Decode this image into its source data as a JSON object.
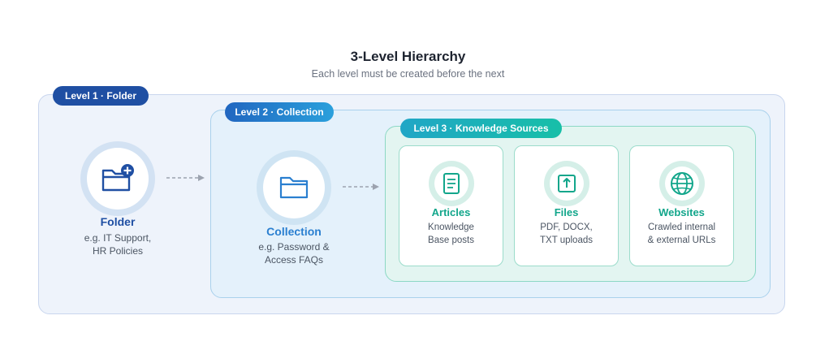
{
  "title": "3-Level Hierarchy",
  "subtitle": "Each level must be created before the next",
  "levels": {
    "level1": {
      "badge": "Level 1 · Folder"
    },
    "level2": {
      "badge": "Level 2 · Collection"
    },
    "level3": {
      "badge": "Level 3 · Knowledge Sources"
    }
  },
  "folder": {
    "label": "Folder",
    "desc_line1": "e.g. IT Support,",
    "desc_line2": "HR Policies",
    "icon": "folder-plus-icon"
  },
  "collection": {
    "label": "Collection",
    "desc_line1": "e.g. Password &",
    "desc_line2": "Access FAQs",
    "icon": "folder-open-icon"
  },
  "sources": [
    {
      "label": "Articles",
      "desc_line1": "Knowledge",
      "desc_line2": "Base posts",
      "icon": "document-icon"
    },
    {
      "label": "Files",
      "desc_line1": "PDF, DOCX,",
      "desc_line2": "TXT uploads",
      "icon": "upload-icon"
    },
    {
      "label": "Websites",
      "desc_line1": "Crawled internal",
      "desc_line2": "& external URLs",
      "icon": "globe-icon"
    }
  ],
  "colors": {
    "level1": "#1f4fa3",
    "level2": "#2a7fd0",
    "level3": "#18b5a0",
    "folder_text": "#1f4fa3",
    "collection_text": "#2a7fd0",
    "source_text": "#12a68b"
  }
}
